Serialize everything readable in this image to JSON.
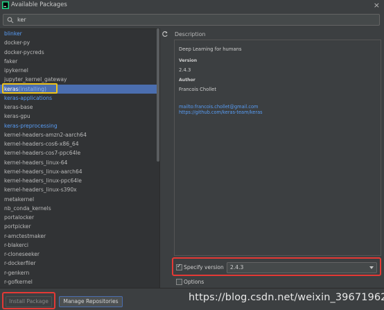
{
  "window": {
    "title": "Available Packages",
    "close_glyph": "×"
  },
  "search": {
    "value": "ker",
    "placeholder": ""
  },
  "packages": [
    {
      "name": "blinker",
      "suffix": "",
      "style": "link"
    },
    {
      "name": "docker-py",
      "suffix": "",
      "style": "normal"
    },
    {
      "name": "docker-pycreds",
      "suffix": "",
      "style": "normal"
    },
    {
      "name": "faker",
      "suffix": "",
      "style": "normal"
    },
    {
      "name": "ipykernel",
      "suffix": "",
      "style": "normal"
    },
    {
      "name": "jupyter_kernel_gateway",
      "suffix": "",
      "style": "normal"
    },
    {
      "name": "keras",
      "suffix": "(installing)",
      "style": "selected"
    },
    {
      "name": "keras-applications",
      "suffix": "",
      "style": "link"
    },
    {
      "name": "keras-base",
      "suffix": "",
      "style": "normal"
    },
    {
      "name": "keras-gpu",
      "suffix": "",
      "style": "normal"
    },
    {
      "name": "keras-preprocessing",
      "suffix": "",
      "style": "link"
    },
    {
      "name": "kernel-headers-amzn2-aarch64",
      "suffix": "",
      "style": "normal"
    },
    {
      "name": "kernel-headers-cos6-x86_64",
      "suffix": "",
      "style": "normal"
    },
    {
      "name": "kernel-headers-cos7-ppc64le",
      "suffix": "",
      "style": "normal"
    },
    {
      "name": "kernel-headers_linux-64",
      "suffix": "",
      "style": "normal"
    },
    {
      "name": "kernel-headers_linux-aarch64",
      "suffix": "",
      "style": "normal"
    },
    {
      "name": "kernel-headers_linux-ppc64le",
      "suffix": "",
      "style": "normal"
    },
    {
      "name": "kernel-headers_linux-s390x",
      "suffix": "",
      "style": "normal"
    },
    {
      "name": "metakernel",
      "suffix": "",
      "style": "normal"
    },
    {
      "name": "nb_conda_kernels",
      "suffix": "",
      "style": "normal"
    },
    {
      "name": "portalocker",
      "suffix": "",
      "style": "normal"
    },
    {
      "name": "portpicker",
      "suffix": "",
      "style": "normal"
    },
    {
      "name": "r-amctestmaker",
      "suffix": "",
      "style": "normal"
    },
    {
      "name": "r-blakerci",
      "suffix": "",
      "style": "normal"
    },
    {
      "name": "r-cloneseeker",
      "suffix": "",
      "style": "normal"
    },
    {
      "name": "r-dockerfiler",
      "suffix": "",
      "style": "normal"
    },
    {
      "name": "r-genkern",
      "suffix": "",
      "style": "normal"
    },
    {
      "name": "r-gofkernel",
      "suffix": "",
      "style": "normal"
    }
  ],
  "description": {
    "label": "Description",
    "summary": "Deep Learning for humans",
    "version_heading": "Version",
    "version_value": "2.4.3",
    "author_heading": "Author",
    "author_value": "Francois Chollet",
    "email_link": "mailto:francois.chollet@gmail.com",
    "repo_link": "https://github.com/keras-team/keras"
  },
  "specify_version": {
    "label": "Specify version",
    "checked": true,
    "selected": "2.4.3"
  },
  "options": {
    "label": "Options",
    "checked": false
  },
  "buttons": {
    "install": "Install Package",
    "manage_repos": "Manage Repositories"
  },
  "watermark": "https://blog.csdn.net/weixin_39671962",
  "colors": {
    "background": "#3c3f41",
    "list_background": "#313335",
    "selection": "#4b6eaf",
    "link": "#589df6",
    "highlight_red": "#e53935",
    "highlight_yellow": "#f0c419"
  },
  "icons": {
    "app": "pycharm-app-icon",
    "search": "search-icon",
    "refresh": "refresh-icon",
    "dropdown": "chevron-down-icon",
    "close": "close-icon"
  }
}
